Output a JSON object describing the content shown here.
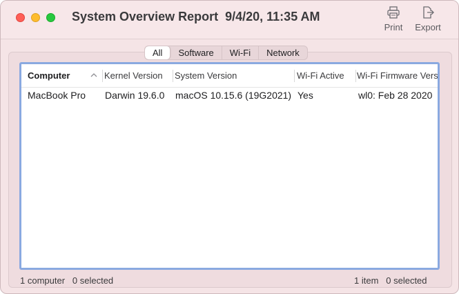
{
  "window": {
    "title": "System Overview Report",
    "timestamp": "9/4/20, 11:35 AM"
  },
  "toolbar": {
    "print_label": "Print",
    "export_label": "Export"
  },
  "tabs": [
    {
      "label": "All",
      "active": true
    },
    {
      "label": "Software",
      "active": false
    },
    {
      "label": "Wi-Fi",
      "active": false
    },
    {
      "label": "Network",
      "active": false
    }
  ],
  "table": {
    "columns": [
      "Computer",
      "Kernel Version",
      "System Version",
      "Wi-Fi Active",
      "Wi-Fi Firmware Vers"
    ],
    "sorted_column": "Computer",
    "sort_direction": "ascending",
    "rows": [
      [
        "MacBook Pro",
        "Darwin 19.6.0",
        "macOS 10.15.6 (19G2021)",
        "Yes",
        "wl0: Feb 28 2020"
      ]
    ]
  },
  "footer": {
    "left_count": "1 computer",
    "left_selected": "0 selected",
    "right_count": "1 item",
    "right_selected": "0 selected"
  },
  "colors": {
    "window_bg": "#f5e4e6",
    "table_focus_ring": "#8aa9e0",
    "close": "#ff5f57",
    "minimize": "#febc2e",
    "zoom": "#28c840"
  },
  "icons": {
    "print": "printer-icon",
    "export": "export-icon",
    "sort": "chevron-up-icon"
  }
}
